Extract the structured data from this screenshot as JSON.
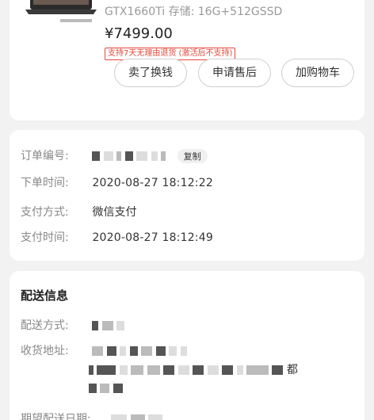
{
  "product": {
    "spec": "GTX1660Ti  存储: 16G+512GSSD",
    "price": "¥7499.00",
    "return_tag": "支持7天无理由退货 (激活后不支持)",
    "buttons": {
      "sell": "卖了换钱",
      "after_sales": "申请售后",
      "add_cart": "加购物车"
    }
  },
  "order": {
    "number_label": "订单编号:",
    "copy_label": "复制",
    "placed_label": "下单时间:",
    "placed_time": "2020-08-27 18:12:22",
    "payment_method_label": "支付方式:",
    "payment_method": "微信支付",
    "payment_time_label": "支付时间:",
    "payment_time": "2020-08-27 18:12:49"
  },
  "delivery": {
    "title": "配送信息",
    "method_label": "配送方式:",
    "address_label": "收货地址:",
    "address_char_1": "都",
    "expected_label": "期望配送日期:"
  },
  "colors": {
    "accent_red": "#e5483b",
    "background": "#f2f2f2"
  }
}
